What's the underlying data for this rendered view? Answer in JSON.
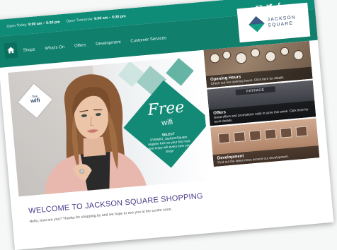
{
  "hours": {
    "today_label": "Open Today:",
    "today_value": "9:00 am – 5:30 pm",
    "tomorrow_label": "Open Tomorrow:",
    "tomorrow_value": "9:00 am – 5:30 pm"
  },
  "logo": {
    "line1": "JACKSON",
    "line2": "SQUARE"
  },
  "social": [
    "email-icon",
    "twitter-icon",
    "facebook-icon"
  ],
  "nav": [
    "Shops",
    "What's On",
    "Offers",
    "Development",
    "Customer Services"
  ],
  "hero": {
    "wifi_badge_small": "free",
    "wifi_badge_big": "wifi",
    "free_title": "Free",
    "free_sub": "wifi",
    "free_body_bold": "SELECT",
    "free_body": "SY6WIFI_JacksonSquare register free on your first visit and enjoy wifi every time you shop!"
  },
  "tiles": [
    {
      "title": "Opening Hours",
      "text": "Check out our opening hours. Click here for details."
    },
    {
      "title": "Offers",
      "text": "Great offers and promotions valid in store this week. Click here for more details."
    },
    {
      "title": "Development",
      "text": "Find out the latest news around our development."
    }
  ],
  "tile2_store": "FATFACE",
  "welcome": {
    "title": "WELCOME TO JACKSON SQUARE SHOPPING",
    "subtitle": "Hello, how are you? Thanks for shopping by and we hope to see you at the centre soon."
  },
  "colors": {
    "brand_teal": "#0f8c78",
    "brand_navy": "#2c4467",
    "heading_purple": "#4b3a8a"
  }
}
